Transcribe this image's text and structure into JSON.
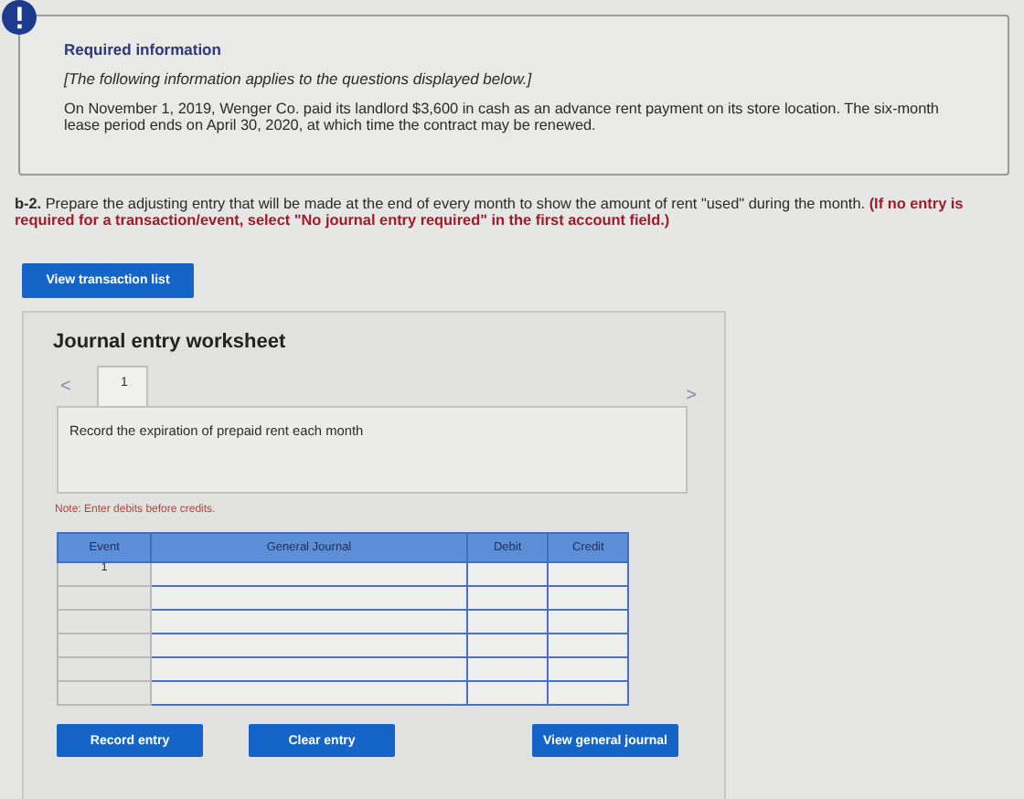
{
  "info": {
    "heading": "Required information",
    "note": "[The following information applies to the questions displayed below.]",
    "body": "On November 1, 2019, Wenger Co. paid its landlord $3,600 in cash as an advance rent payment on its store location. The six-month lease period ends on April 30, 2020, at which time the contract may be renewed."
  },
  "question": {
    "text": "**b-2.** Prepare the adjusting entry that will be made at the end of every month to show the amount of rent \"used\" during the month.",
    "instruction": "(If no entry is required for a transaction/event, select \"No journal entry required\" in the first account field.)"
  },
  "transaction_button": "View transaction list",
  "worksheet": {
    "title": "Journal entry worksheet",
    "prev": "<",
    "next": ">",
    "tabs": [
      {
        "label": "1",
        "selected": true
      }
    ],
    "description": "Record the expiration of prepaid rent each month",
    "note": "Note: Enter debits before credits.",
    "table": {
      "columns": [
        "Event",
        "General Journal",
        "Debit",
        "Credit"
      ],
      "rows": [
        {
          "event": "1"
        },
        {},
        {},
        {},
        {},
        {}
      ]
    },
    "buttons": [
      "Record entry",
      "Clear entry",
      "View general journal"
    ]
  }
}
